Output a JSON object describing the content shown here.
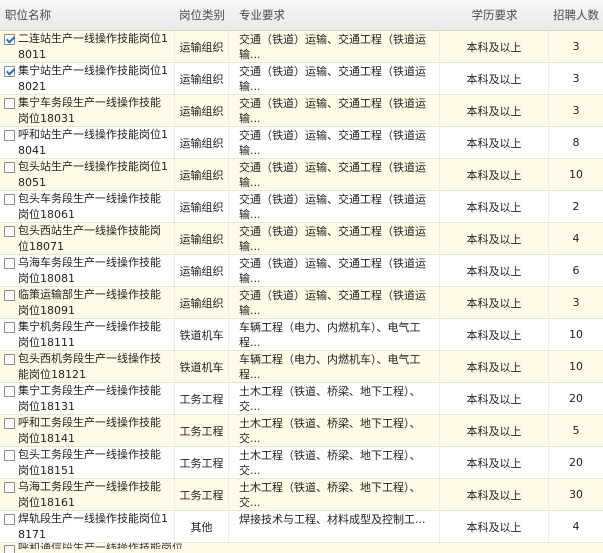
{
  "headers": {
    "name": "职位名称",
    "category": "岗位类别",
    "major": "专业要求",
    "education": "学历要求",
    "count": "招聘人数"
  },
  "rows": [
    {
      "checked": true,
      "name": "二连站生产一线操作技能岗位18011",
      "category": "运输组织",
      "major": "交通（铁道）运输、交通工程（铁道运输...",
      "education": "本科及以上",
      "count": "3"
    },
    {
      "checked": true,
      "name": "集宁站生产一线操作技能岗位18021",
      "category": "运输组织",
      "major": "交通（铁道）运输、交通工程（铁道运输...",
      "education": "本科及以上",
      "count": "3"
    },
    {
      "checked": false,
      "name": "集宁车务段生产一线操作技能岗位18031",
      "category": "运输组织",
      "major": "交通（铁道）运输、交通工程（铁道运输...",
      "education": "本科及以上",
      "count": "3"
    },
    {
      "checked": false,
      "name": "呼和站生产一线操作技能岗位18041",
      "category": "运输组织",
      "major": "交通（铁道）运输、交通工程（铁道运输...",
      "education": "本科及以上",
      "count": "8"
    },
    {
      "checked": false,
      "name": "包头站生产一线操作技能岗位18051",
      "category": "运输组织",
      "major": "交通（铁道）运输、交通工程（铁道运输...",
      "education": "本科及以上",
      "count": "10"
    },
    {
      "checked": false,
      "name": "包头车务段生产一线操作技能岗位18061",
      "category": "运输组织",
      "major": "交通（铁道）运输、交通工程（铁道运输...",
      "education": "本科及以上",
      "count": "2"
    },
    {
      "checked": false,
      "name": "包头西站生产一线操作技能岗位18071",
      "category": "运输组织",
      "major": "交通（铁道）运输、交通工程（铁道运输...",
      "education": "本科及以上",
      "count": "4"
    },
    {
      "checked": false,
      "name": "乌海车务段生产一线操作技能岗位18081",
      "category": "运输组织",
      "major": "交通（铁道）运输、交通工程（铁道运输...",
      "education": "本科及以上",
      "count": "6"
    },
    {
      "checked": false,
      "name": "临策运输部生产一线操作技能岗位18091",
      "category": "运输组织",
      "major": "交通（铁道）运输、交通工程（铁道运输...",
      "education": "本科及以上",
      "count": "3"
    },
    {
      "checked": false,
      "name": "集宁机务段生产一线操作技能岗位18111",
      "category": "铁道机车",
      "major": "车辆工程（电力、内燃机车）、电气工程...",
      "education": "本科及以上",
      "count": "10"
    },
    {
      "checked": false,
      "name": "包头西机务段生产一线操作技能岗位18121",
      "category": "铁道机车",
      "major": "车辆工程（电力、内燃机车）、电气工程...",
      "education": "本科及以上",
      "count": "10"
    },
    {
      "checked": false,
      "name": "集宁工务段生产一线操作技能岗位18131",
      "category": "工务工程",
      "major": "土木工程（铁道、桥梁、地下工程）、交...",
      "education": "本科及以上",
      "count": "20"
    },
    {
      "checked": false,
      "name": "呼和工务段生产一线操作技能岗位18141",
      "category": "工务工程",
      "major": "土木工程（铁道、桥梁、地下工程）、交...",
      "education": "本科及以上",
      "count": "5"
    },
    {
      "checked": false,
      "name": "包头工务段生产一线操作技能岗位18151",
      "category": "工务工程",
      "major": "土木工程（铁道、桥梁、地下工程）、交...",
      "education": "本科及以上",
      "count": "20"
    },
    {
      "checked": false,
      "name": "乌海工务段生产一线操作技能岗位18161",
      "category": "工务工程",
      "major": "土木工程（铁道、桥梁、地下工程）、交...",
      "education": "本科及以上",
      "count": "30"
    },
    {
      "checked": false,
      "name": "焊轨段生产一线操作技能岗位18171",
      "category": "其他",
      "major": "焊接技术与工程、材料成型及控制工...",
      "education": "本科及以上",
      "count": "4"
    }
  ],
  "peek_row": {
    "name": "呼和通信段生产一线操作技能岗位"
  }
}
